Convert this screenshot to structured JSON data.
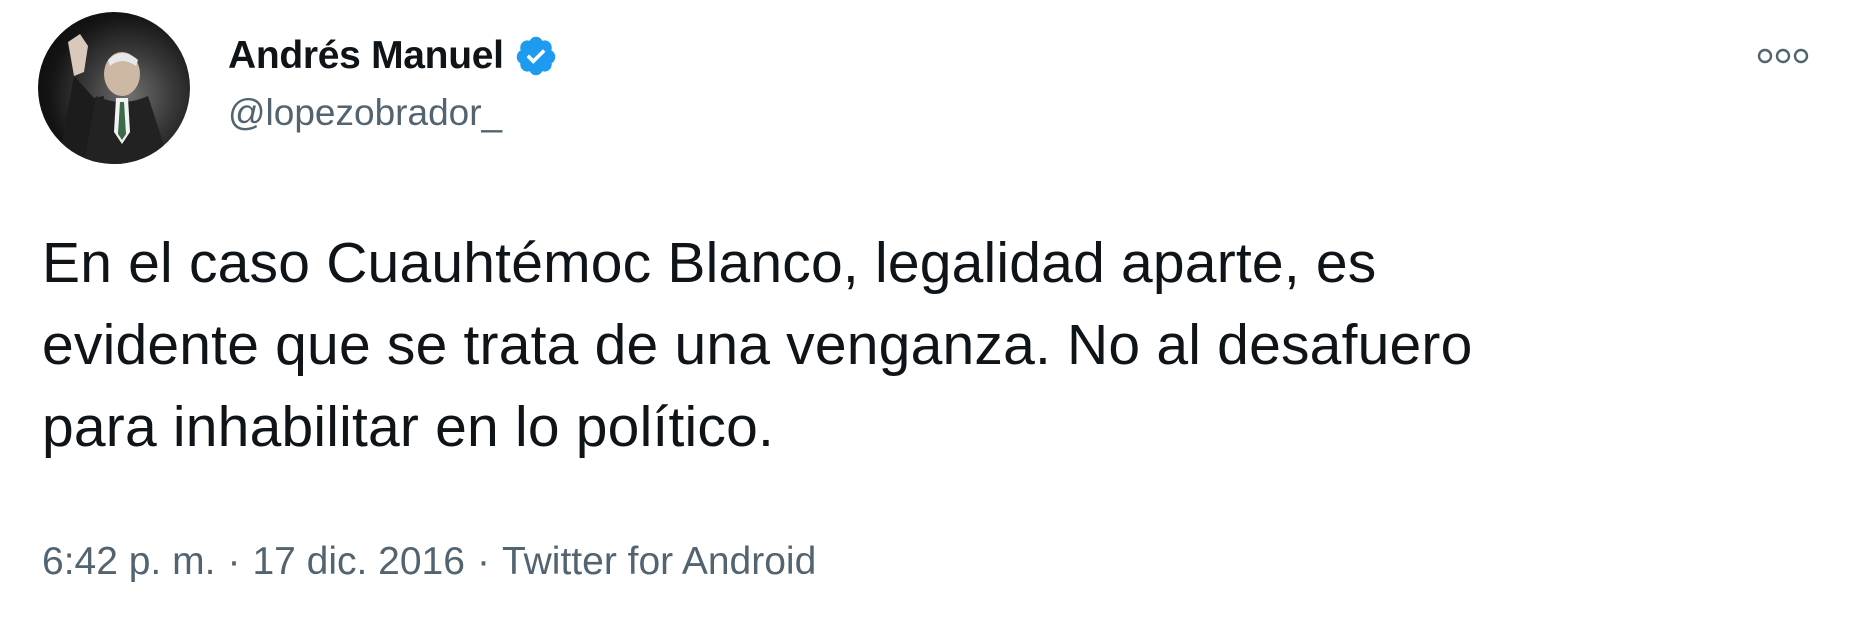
{
  "author": {
    "display_name": "Andrés Manuel",
    "handle": "@lopezobrador_",
    "verified": true
  },
  "tweet": {
    "text_lines": [
      "En el caso Cuauhtémoc Blanco, legalidad aparte, es",
      "evidente que se trata de una venganza. No al desafuero",
      "para inhabilitar en lo político."
    ],
    "time": "6:42 p. m.",
    "date": "17 dic. 2016",
    "source": "Twitter for Android",
    "separator": "·"
  },
  "icons": {
    "verified": "verified-badge-icon",
    "more": "more-options-icon"
  },
  "colors": {
    "verified_blue": "#1d9bf0",
    "text_primary": "#0f1419",
    "text_secondary": "#536471"
  }
}
